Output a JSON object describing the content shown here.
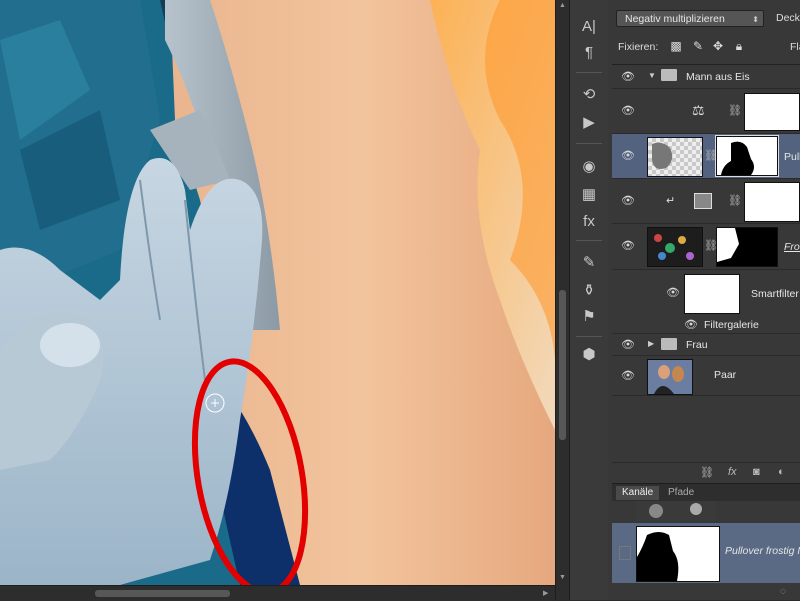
{
  "panel": {
    "blend_mode": "Negativ multiplizieren",
    "opacity_label": "Deckk",
    "fix_label": "Fixieren:",
    "fill_label": "Flä"
  },
  "layers": {
    "group_mann": "Mann aus Eis",
    "pullover": "Pull",
    "frost": "Fros",
    "smartfilter": "Smartfilter",
    "filtergalerie": "Filtergalerie",
    "group_frau": "Frau",
    "paar": "Paar"
  },
  "tabs": {
    "kanaele": "Kanäle",
    "pfade": "Pfade"
  },
  "channels": {
    "selected": "Pullover frostig M"
  },
  "colors": {
    "annotation_ellipse": "#e30000",
    "selected_row": "#52627f",
    "panel_bg": "#383838"
  }
}
